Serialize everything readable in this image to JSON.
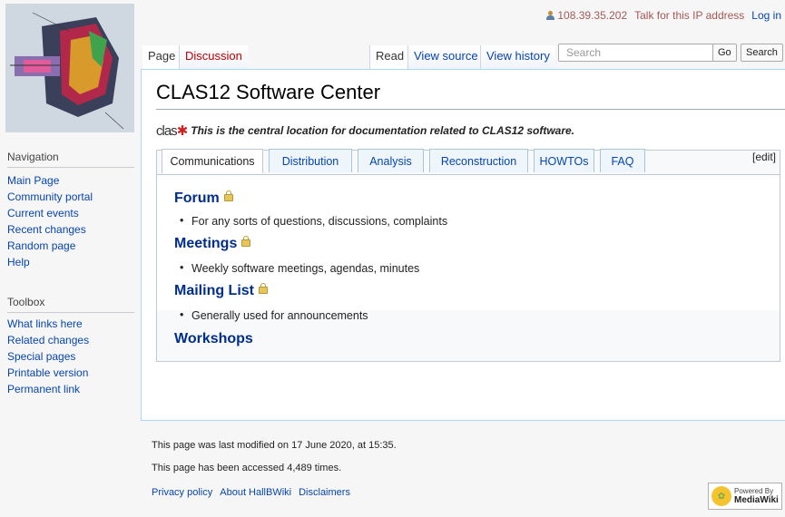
{
  "user_tools": {
    "ip": "108.39.35.202",
    "talk": "Talk for this IP address",
    "login": "Log in"
  },
  "tabs": {
    "page": "Page",
    "discussion": "Discussion",
    "read": "Read",
    "view_source": "View source",
    "view_history": "View history"
  },
  "search": {
    "placeholder": "Search",
    "go": "Go",
    "search": "Search"
  },
  "page_title": "CLAS12 Software Center",
  "intro": {
    "logo_text": "clas",
    "text": "This is the central location for documentation related to CLAS12 software."
  },
  "portal_tabs": [
    "Communications",
    "Distribution",
    "Analysis",
    "Reconstruction",
    "HOWTOs",
    "FAQ"
  ],
  "edit_label": "[edit]",
  "sections": [
    {
      "title": "Forum",
      "locked": true,
      "bullet": "For any sorts of questions, discussions, complaints"
    },
    {
      "title": "Meetings",
      "locked": true,
      "bullet": "Weekly software meetings, agendas, minutes"
    },
    {
      "title": "Mailing List",
      "locked": true,
      "bullet": "Generally used for announcements"
    },
    {
      "title": "Workshops",
      "locked": false,
      "bullet": ""
    }
  ],
  "sidebar": {
    "navigation_heading": "Navigation",
    "navigation": [
      "Main Page",
      "Community portal",
      "Current events",
      "Recent changes",
      "Random page",
      "Help"
    ],
    "toolbox_heading": "Toolbox",
    "toolbox": [
      "What links here",
      "Related changes",
      "Special pages",
      "Printable version",
      "Permanent link"
    ]
  },
  "footer": {
    "last_modified": "This page was last modified on 17 June 2020, at 15:35.",
    "accessed": "This page has been accessed 4,489 times.",
    "links": [
      "Privacy policy",
      "About HallBWiki",
      "Disclaimers"
    ],
    "badge_small": "Powered By",
    "badge_big": "MediaWiki"
  },
  "colors": {
    "link": "#0645ad",
    "section_heading": "#002e8c",
    "red_link": "#ba0000",
    "content_border": "#a7d7f9"
  }
}
